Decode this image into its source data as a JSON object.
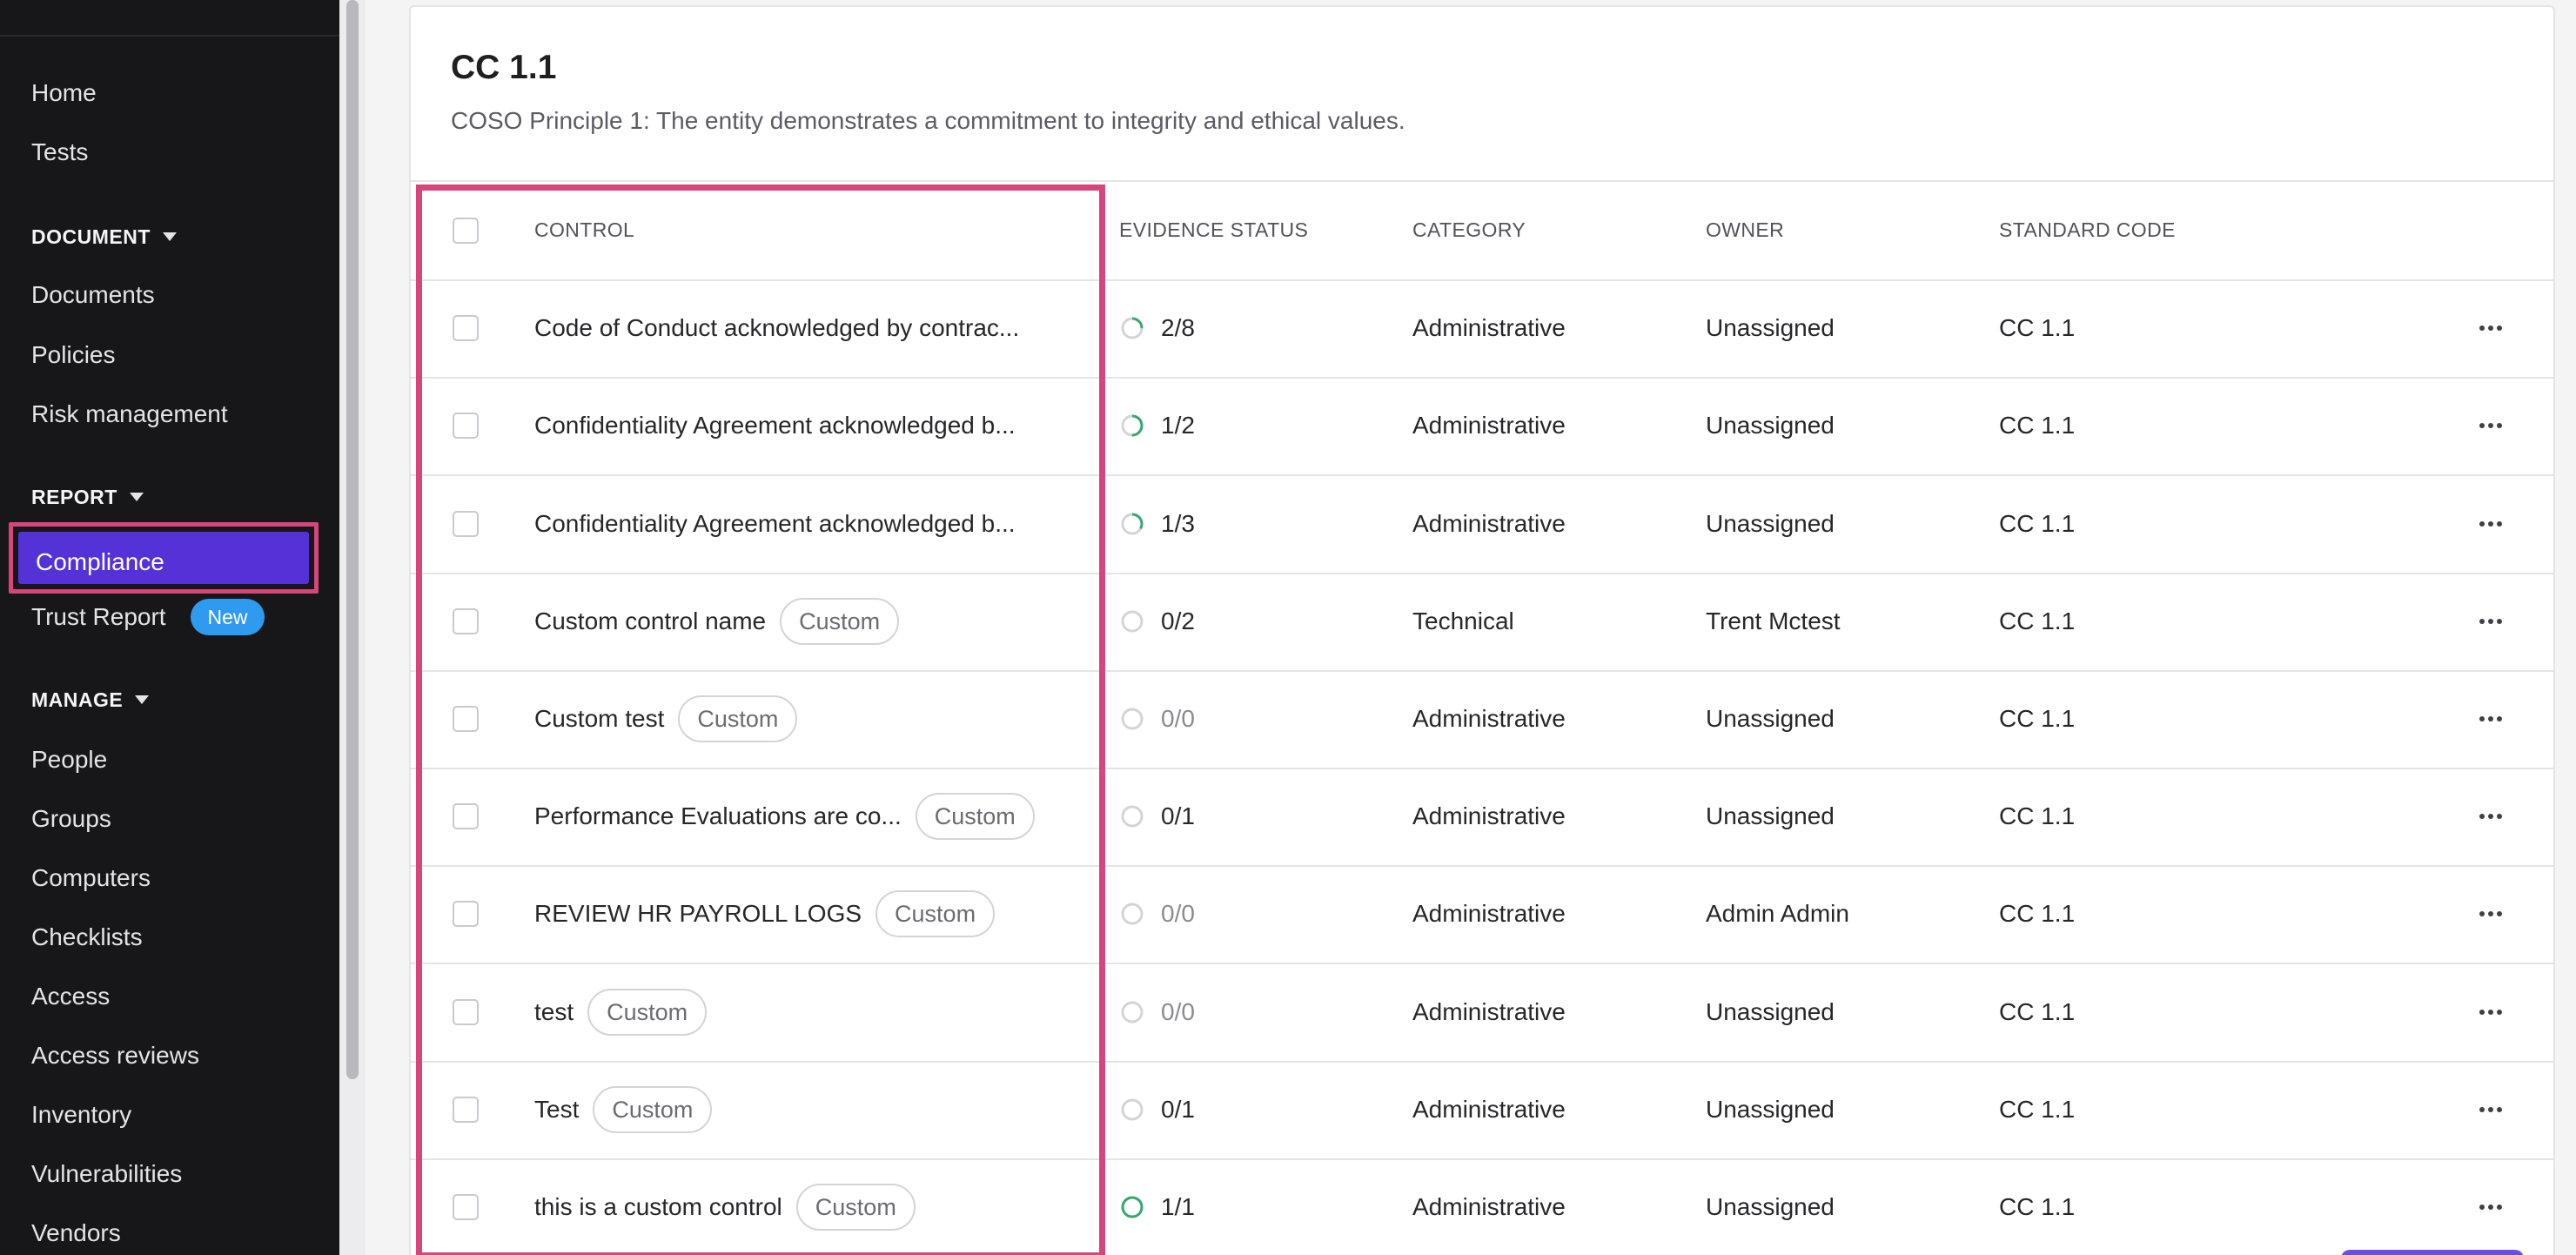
{
  "sidebar": {
    "top_items": [
      {
        "label": "Home"
      },
      {
        "label": "Tests"
      }
    ],
    "sections": [
      {
        "title": "DOCUMENT",
        "items": [
          {
            "label": "Documents"
          },
          {
            "label": "Policies"
          },
          {
            "label": "Risk management"
          }
        ]
      },
      {
        "title": "REPORT",
        "items": [
          {
            "label": "Compliance",
            "active": true
          },
          {
            "label": "Trust Report",
            "badge": "New"
          }
        ]
      },
      {
        "title": "MANAGE",
        "items": [
          {
            "label": "People"
          },
          {
            "label": "Groups"
          },
          {
            "label": "Computers"
          },
          {
            "label": "Checklists"
          },
          {
            "label": "Access"
          },
          {
            "label": "Access reviews"
          },
          {
            "label": "Inventory"
          },
          {
            "label": "Vulnerabilities"
          },
          {
            "label": "Vendors"
          }
        ]
      }
    ]
  },
  "card": {
    "title": "CC 1.1",
    "subtitle": "COSO Principle 1: The entity demonstrates a commitment to integrity and ethical values."
  },
  "table": {
    "headers": {
      "control": "CONTROL",
      "evidence_status": "EVIDENCE STATUS",
      "category": "CATEGORY",
      "owner": "OWNER",
      "standard_code": "STANDARD CODE"
    },
    "rows": [
      {
        "control": "Code of Conduct acknowledged by contrac...",
        "custom": "",
        "evidence": "2/8",
        "progress": 0.25,
        "category": "Administrative",
        "owner": "Unassigned",
        "code": "CC 1.1"
      },
      {
        "control": "Confidentiality Agreement acknowledged b...",
        "custom": "",
        "evidence": "1/2",
        "progress": 0.5,
        "category": "Administrative",
        "owner": "Unassigned",
        "code": "CC 1.1"
      },
      {
        "control": "Confidentiality Agreement acknowledged b...",
        "custom": "",
        "evidence": "1/3",
        "progress": 0.33,
        "category": "Administrative",
        "owner": "Unassigned",
        "code": "CC 1.1"
      },
      {
        "control": "Custom control name",
        "custom": "Custom",
        "evidence": "0/2",
        "progress": 0,
        "category": "Technical",
        "owner": "Trent Mctest",
        "code": "CC 1.1"
      },
      {
        "control": "Custom test",
        "custom": "Custom",
        "evidence": "0/0",
        "progress": 0,
        "category": "Administrative",
        "owner": "Unassigned",
        "code": "CC 1.1"
      },
      {
        "control": "Performance Evaluations are co...",
        "custom": "Custom",
        "evidence": "0/1",
        "progress": 0,
        "category": "Administrative",
        "owner": "Unassigned",
        "code": "CC 1.1"
      },
      {
        "control": "REVIEW HR PAYROLL LOGS",
        "custom": "Custom",
        "evidence": "0/0",
        "progress": 0,
        "category": "Administrative",
        "owner": "Admin Admin",
        "code": "CC 1.1"
      },
      {
        "control": "test",
        "custom": "Custom",
        "evidence": "0/0",
        "progress": 0,
        "category": "Administrative",
        "owner": "Unassigned",
        "code": "CC 1.1"
      },
      {
        "control": "Test",
        "custom": "Custom",
        "evidence": "0/1",
        "progress": 0,
        "category": "Administrative",
        "owner": "Unassigned",
        "code": "CC 1.1"
      },
      {
        "control": "this is a custom control",
        "custom": "Custom",
        "evidence": "1/1",
        "progress": 1,
        "category": "Administrative",
        "owner": "Unassigned",
        "code": "CC 1.1"
      }
    ]
  },
  "colors": {
    "sidebar_bg": "#17171a",
    "active_nav": "#5531d8",
    "highlight": "#d6457c",
    "badge": "#2f9bf0",
    "progress_green": "#3aa76d",
    "empty_ring": "#d4d4d8"
  }
}
